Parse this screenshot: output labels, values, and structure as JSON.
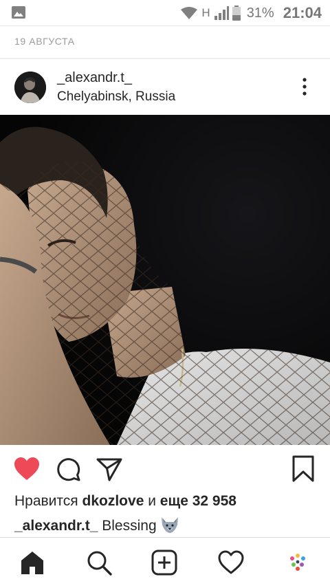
{
  "status_bar": {
    "network_type": "H",
    "battery_percent": "31%",
    "time": "21:04",
    "icons": [
      "gallery-icon",
      "wifi-icon",
      "signal-icon",
      "battery-icon"
    ]
  },
  "feed": {
    "date_label": "19 АВГУСТА"
  },
  "post": {
    "username": "_alexandr.t_",
    "location": "Chelyabinsk, Russia",
    "liked": true,
    "likes": {
      "prefix": "Нравится",
      "user": "dkozlove",
      "joiner": "и",
      "more": "еще 32 958"
    },
    "caption": {
      "user": "_alexandr.t_",
      "text": "Blessing",
      "emoji": "wolf"
    }
  },
  "colors": {
    "like_red": "#ed4956",
    "text": "#262626",
    "muted": "#9a9a9a"
  },
  "bottom_nav": [
    "home-icon",
    "search-icon",
    "add-post-icon",
    "activity-heart-icon",
    "profile-avatar-icon"
  ]
}
